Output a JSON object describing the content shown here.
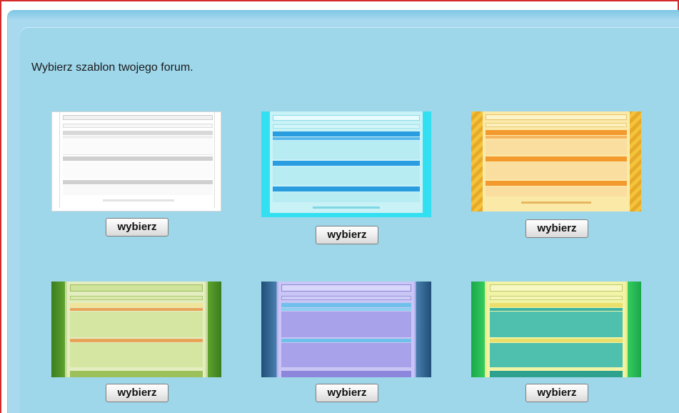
{
  "heading": "Wybierz szablon twojego forum.",
  "templates": [
    {
      "name": "white",
      "button_label": "wybierz"
    },
    {
      "name": "cyan",
      "button_label": "wybierz"
    },
    {
      "name": "orange",
      "button_label": "wybierz"
    },
    {
      "name": "green",
      "button_label": "wybierz"
    },
    {
      "name": "blue-purple",
      "button_label": "wybierz"
    },
    {
      "name": "lime-teal",
      "button_label": "wybierz"
    }
  ],
  "colors": {
    "frame_border": "#d42a2a",
    "panel_bg": "#9ed6ea",
    "outer_bg": "#a8d9ee"
  }
}
